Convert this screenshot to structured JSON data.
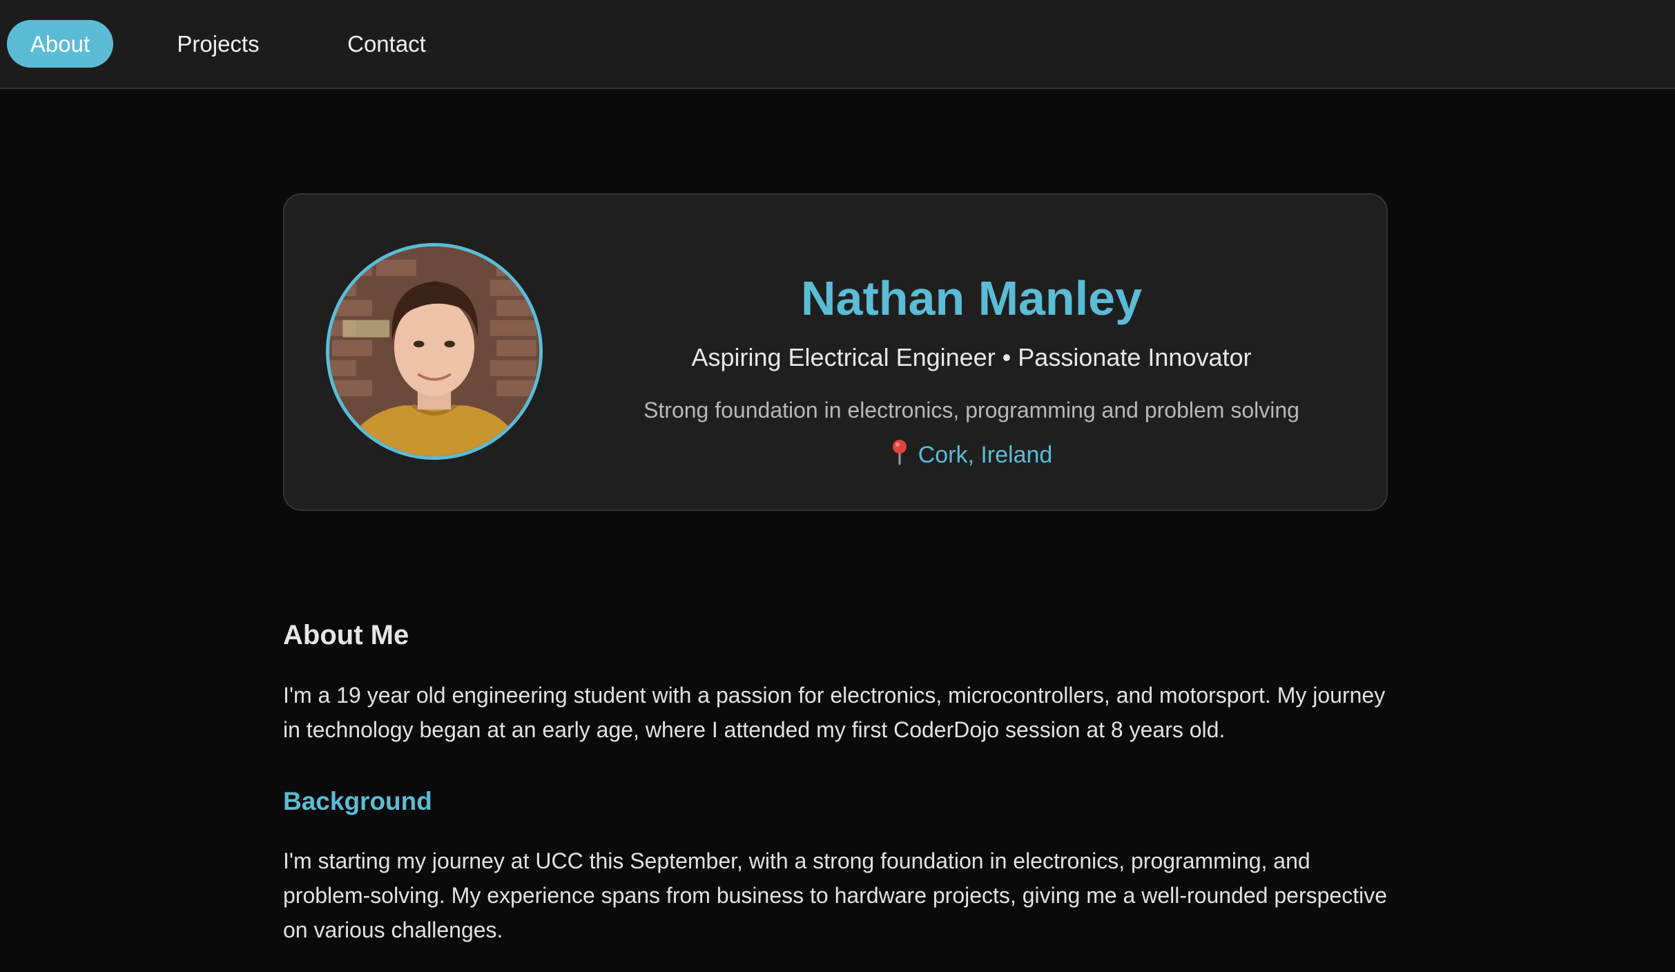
{
  "nav": {
    "items": [
      {
        "label": "About",
        "active": true
      },
      {
        "label": "Projects",
        "active": false
      },
      {
        "label": "Contact",
        "active": false
      }
    ]
  },
  "profile": {
    "name": "Nathan Manley",
    "tagline": "Aspiring Electrical Engineer • Passionate Innovator",
    "summary": "Strong foundation in electronics, programming and problem solving",
    "location": "Cork, Ireland",
    "location_icon": "map-pin-icon"
  },
  "about": {
    "heading": "About Me",
    "paragraph": "I'm a 19 year old engineering student with a passion for electronics, microcontrollers, and motorsport. My journey in technology began at an early age, where I attended my first CoderDojo session at 8 years old."
  },
  "background": {
    "heading": "Background",
    "paragraph": "I'm starting my journey at UCC this September, with a strong foundation in electronics, programming, and problem-solving. My experience spans from business to hardware projects, giving me a well-rounded perspective on various challenges."
  },
  "colors": {
    "accent": "#5bbcd6",
    "page_background": "#0a0a0a",
    "nav_background": "#1c1c1c",
    "card_background": "#1f1f1f"
  }
}
